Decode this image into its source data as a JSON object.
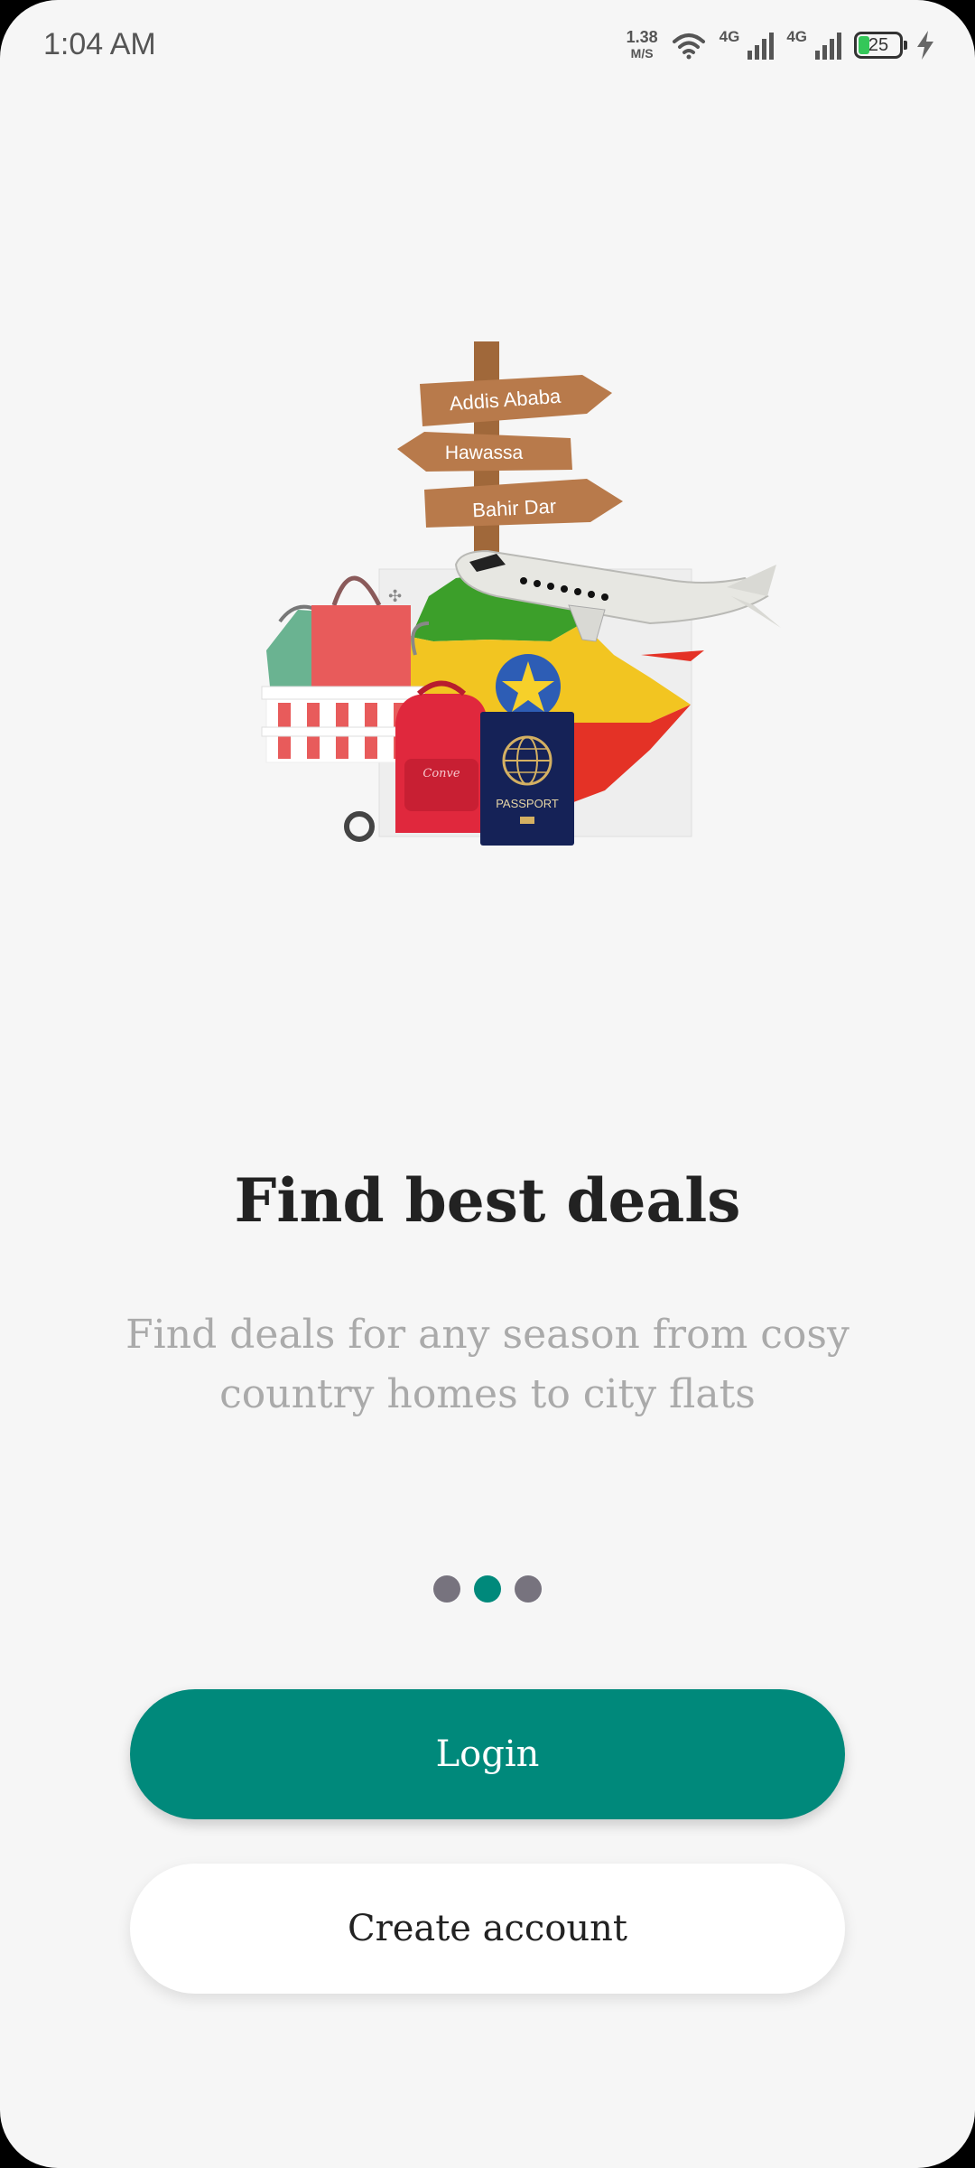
{
  "status_bar": {
    "time": "1:04 AM",
    "net_speed_value": "1.38",
    "net_speed_unit": "M/S",
    "signal1_label": "4G",
    "signal2_label": "4G",
    "battery_level": "25"
  },
  "illustration": {
    "signposts": [
      "Addis Ababa",
      "Hawassa",
      "Bahir Dar"
    ],
    "passport_label": "PASSPORT",
    "backpack_label": "Conve"
  },
  "onboarding": {
    "title": "Find best deals",
    "subtitle": "Find deals for any season from cosy country homes to city flats",
    "page_count": 3,
    "active_page": 2
  },
  "actions": {
    "login_label": "Login",
    "create_account_label": "Create account"
  },
  "colors": {
    "accent": "#00897b",
    "background": "#f6f6f6",
    "inactive_dot": "#77737e"
  }
}
